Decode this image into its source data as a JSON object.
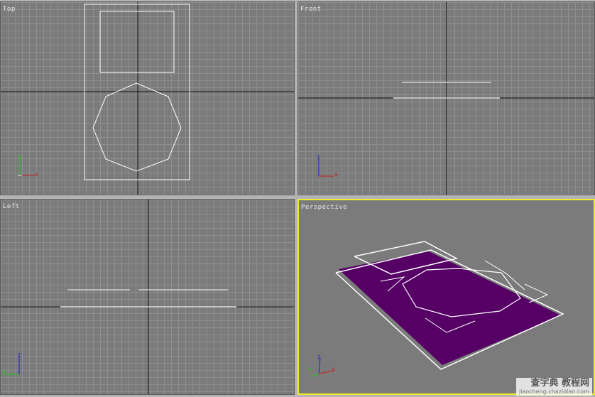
{
  "viewports": {
    "top": {
      "label": "Top"
    },
    "front": {
      "label": "Front"
    },
    "left": {
      "label": "Left"
    },
    "perspective": {
      "label": "Perspective"
    }
  },
  "gizmo_labels": {
    "x": "x",
    "y": "y",
    "z": "z"
  },
  "colors": {
    "active_border": "#f0ec2c",
    "surface_fill": "#560066",
    "wire": "#ffffff",
    "axis_x": "#c81e1e",
    "axis_y": "#1ec81e",
    "axis_z": "#1e1ec8"
  },
  "watermark": {
    "title": "查字典 教程网",
    "url": "jiaocheng.chazidian.com"
  }
}
